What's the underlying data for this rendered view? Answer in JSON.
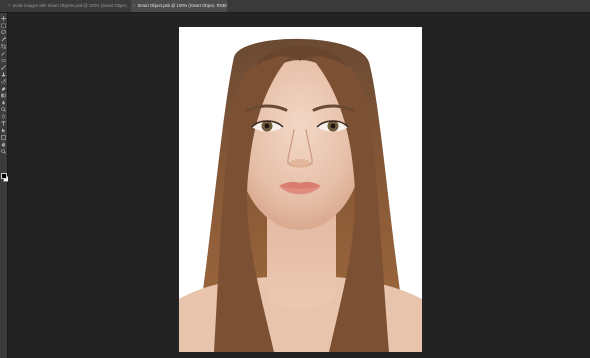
{
  "tabs": [
    {
      "label": "Scale Images with Smart Objects.psd @ 100% (Smart Object, RGB/8) *",
      "close": "×",
      "active": false
    },
    {
      "label": "Smart Object.psb @ 100% (Smart Object, RGB/8)",
      "close": "×",
      "active": true
    }
  ],
  "toolbar": {
    "tools": [
      "move-tool",
      "marquee-tool",
      "lasso-tool",
      "quick-selection-tool",
      "crop-tool",
      "eyedropper-tool",
      "healing-brush-tool",
      "brush-tool",
      "clone-stamp-tool",
      "history-brush-tool",
      "eraser-tool",
      "gradient-tool",
      "blur-tool",
      "dodge-tool",
      "pen-tool",
      "type-tool",
      "path-selection-tool",
      "shape-tool",
      "hand-tool",
      "zoom-tool"
    ],
    "foreground_color": "#000000",
    "background_color": "#ffffff"
  },
  "colors": {
    "app_background": "#232323",
    "tabbar": "#3a3a3a",
    "toolbar": "#3c3c3c",
    "document_background": "#ffffff"
  }
}
